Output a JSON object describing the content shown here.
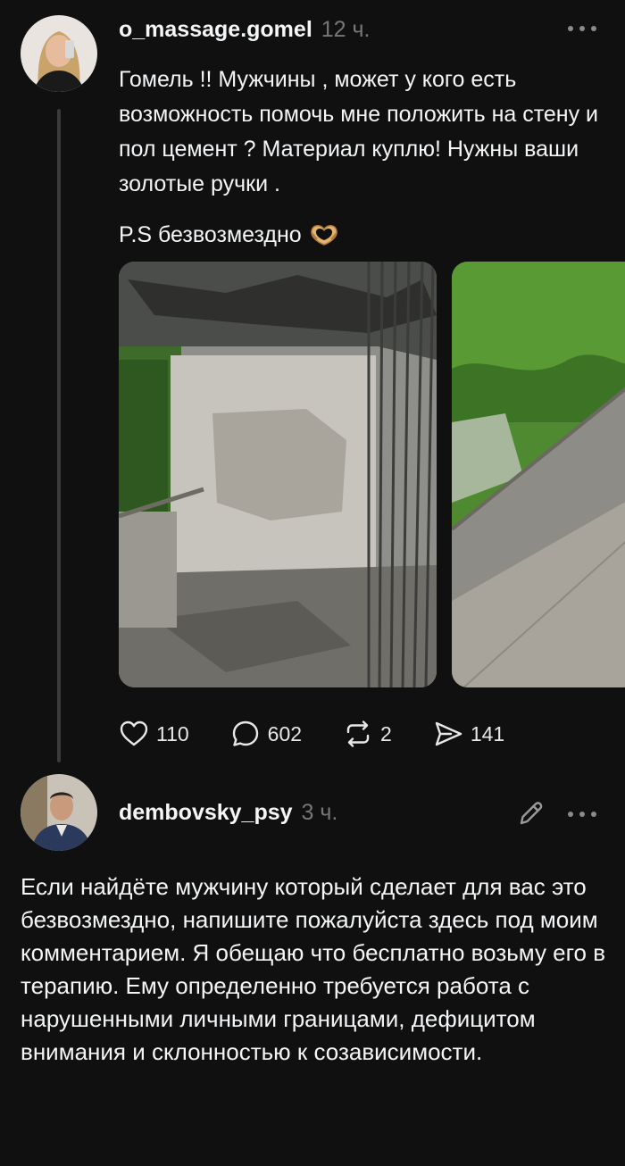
{
  "post": {
    "username": "o_massage.gomel",
    "time": "12 ч.",
    "text": "Гомель !! Мужчины , может у кого есть возможность помочь мне положить на стену и пол цемент ? Материал куплю! Нужны ваши золотые ручки .",
    "ps": "P.S безвозмездно",
    "emoji": "heart-hands-icon",
    "stats": {
      "likes": "110",
      "replies": "602",
      "reposts": "2",
      "shares": "141"
    }
  },
  "comment": {
    "username": "dembovsky_psy",
    "time": "3 ч.",
    "text": "Если найдёте мужчину который сделает для вас это безвозмездно, напишите пожалуйста здесь под моим комментарием. Я обещаю что бесплатно возьму его в терапию. Ему определенно требуется работа с нарушенными личными границами, дефицитом внимания и склонностью к созависимости."
  },
  "colors": {
    "background": "#101010",
    "text": "#f3f5f7",
    "muted": "#777777",
    "thread_line": "#3a3a3a"
  }
}
